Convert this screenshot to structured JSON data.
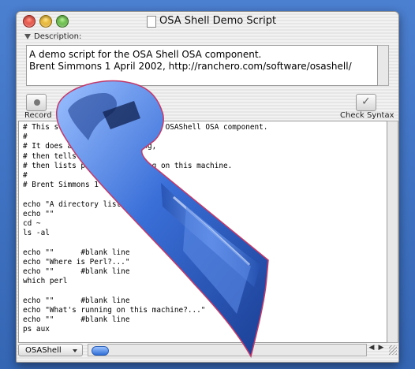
{
  "window": {
    "title": "OSA Shell Demo Script"
  },
  "description": {
    "label": "Description:",
    "text": "A demo script for the OSA Shell OSA component.\nBrent Simmons 1 April 2002, http://ranchero.com/software/osashell/"
  },
  "toolbar": {
    "record_label": "Record",
    "check_syntax_label": "Check Syntax"
  },
  "editor": {
    "code": "# This script is a demo for the OSAShell OSA component.\n#\n# It does a directory listing,\n# then tells where Perl is,\n# then lists processes running on this machine.\n#\n# Brent Simmons 1 April 2002\n\necho \"A directory listing...\"\necho \"\"\ncd ~\nls -al\n\necho \"\"      #blank line\necho \"Where is Perl?...\"\necho \"\"      #blank line\nwhich perl\n\necho \"\"      #blank line\necho \"What's running on this machine?...\"\necho \"\"      #blank line\nps aux"
  },
  "language_popup": {
    "value": "OSAShell"
  },
  "icons": {
    "close": "close-button-icon",
    "minimize": "minimize-button-icon",
    "zoom": "zoom-button-icon",
    "document": "document-icon",
    "record": "record-icon",
    "check": "checkmark-icon",
    "wrench": "wrench-icon"
  },
  "colors": {
    "desktop": "#3b6fc0",
    "wrench": "#3a6fd8",
    "scroll_thumb": "#2f6fd6"
  }
}
